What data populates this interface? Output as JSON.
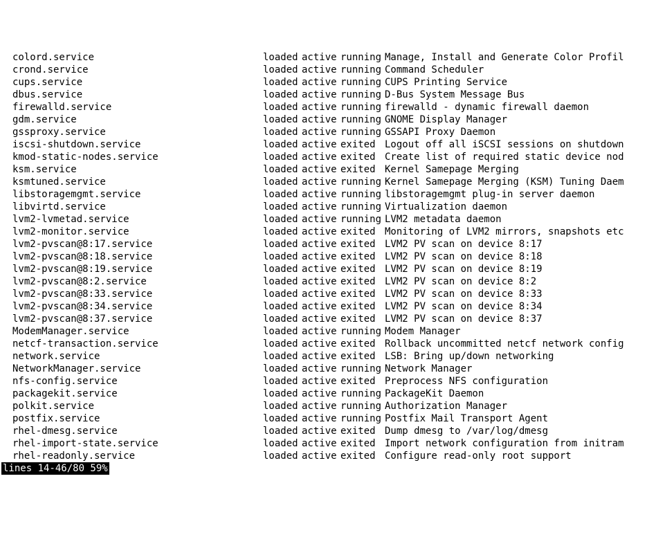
{
  "rows": [
    {
      "unit": "colord.service",
      "load": "loaded",
      "active": "active",
      "sub": "running",
      "desc": "Manage, Install and Generate Color Profil"
    },
    {
      "unit": "crond.service",
      "load": "loaded",
      "active": "active",
      "sub": "running",
      "desc": "Command Scheduler"
    },
    {
      "unit": "cups.service",
      "load": "loaded",
      "active": "active",
      "sub": "running",
      "desc": "CUPS Printing Service"
    },
    {
      "unit": "dbus.service",
      "load": "loaded",
      "active": "active",
      "sub": "running",
      "desc": "D-Bus System Message Bus"
    },
    {
      "unit": "firewalld.service",
      "load": "loaded",
      "active": "active",
      "sub": "running",
      "desc": "firewalld - dynamic firewall daemon"
    },
    {
      "unit": "gdm.service",
      "load": "loaded",
      "active": "active",
      "sub": "running",
      "desc": "GNOME Display Manager"
    },
    {
      "unit": "gssproxy.service",
      "load": "loaded",
      "active": "active",
      "sub": "running",
      "desc": "GSSAPI Proxy Daemon"
    },
    {
      "unit": "iscsi-shutdown.service",
      "load": "loaded",
      "active": "active",
      "sub": "exited ",
      "desc": "Logout off all iSCSI sessions on shutdown"
    },
    {
      "unit": "kmod-static-nodes.service",
      "load": "loaded",
      "active": "active",
      "sub": "exited ",
      "desc": "Create list of required static device nod"
    },
    {
      "unit": "ksm.service",
      "load": "loaded",
      "active": "active",
      "sub": "exited ",
      "desc": "Kernel Samepage Merging"
    },
    {
      "unit": "ksmtuned.service",
      "load": "loaded",
      "active": "active",
      "sub": "running",
      "desc": "Kernel Samepage Merging (KSM) Tuning Daem"
    },
    {
      "unit": "libstoragemgmt.service",
      "load": "loaded",
      "active": "active",
      "sub": "running",
      "desc": "libstoragemgmt plug-in server daemon"
    },
    {
      "unit": "libvirtd.service",
      "load": "loaded",
      "active": "active",
      "sub": "running",
      "desc": "Virtualization daemon"
    },
    {
      "unit": "lvm2-lvmetad.service",
      "load": "loaded",
      "active": "active",
      "sub": "running",
      "desc": "LVM2 metadata daemon"
    },
    {
      "unit": "lvm2-monitor.service",
      "load": "loaded",
      "active": "active",
      "sub": "exited ",
      "desc": "Monitoring of LVM2 mirrors, snapshots etc"
    },
    {
      "unit": "lvm2-pvscan@8:17.service",
      "load": "loaded",
      "active": "active",
      "sub": "exited ",
      "desc": "LVM2 PV scan on device 8:17"
    },
    {
      "unit": "lvm2-pvscan@8:18.service",
      "load": "loaded",
      "active": "active",
      "sub": "exited ",
      "desc": "LVM2 PV scan on device 8:18"
    },
    {
      "unit": "lvm2-pvscan@8:19.service",
      "load": "loaded",
      "active": "active",
      "sub": "exited ",
      "desc": "LVM2 PV scan on device 8:19"
    },
    {
      "unit": "lvm2-pvscan@8:2.service",
      "load": "loaded",
      "active": "active",
      "sub": "exited ",
      "desc": "LVM2 PV scan on device 8:2"
    },
    {
      "unit": "lvm2-pvscan@8:33.service",
      "load": "loaded",
      "active": "active",
      "sub": "exited ",
      "desc": "LVM2 PV scan on device 8:33"
    },
    {
      "unit": "lvm2-pvscan@8:34.service",
      "load": "loaded",
      "active": "active",
      "sub": "exited ",
      "desc": "LVM2 PV scan on device 8:34"
    },
    {
      "unit": "lvm2-pvscan@8:37.service",
      "load": "loaded",
      "active": "active",
      "sub": "exited ",
      "desc": "LVM2 PV scan on device 8:37"
    },
    {
      "unit": "ModemManager.service",
      "load": "loaded",
      "active": "active",
      "sub": "running",
      "desc": "Modem Manager"
    },
    {
      "unit": "netcf-transaction.service",
      "load": "loaded",
      "active": "active",
      "sub": "exited ",
      "desc": "Rollback uncommitted netcf network config"
    },
    {
      "unit": "network.service",
      "load": "loaded",
      "active": "active",
      "sub": "exited ",
      "desc": "LSB: Bring up/down networking"
    },
    {
      "unit": "NetworkManager.service",
      "load": "loaded",
      "active": "active",
      "sub": "running",
      "desc": "Network Manager"
    },
    {
      "unit": "nfs-config.service",
      "load": "loaded",
      "active": "active",
      "sub": "exited ",
      "desc": "Preprocess NFS configuration"
    },
    {
      "unit": "packagekit.service",
      "load": "loaded",
      "active": "active",
      "sub": "running",
      "desc": "PackageKit Daemon"
    },
    {
      "unit": "polkit.service",
      "load": "loaded",
      "active": "active",
      "sub": "running",
      "desc": "Authorization Manager"
    },
    {
      "unit": "postfix.service",
      "load": "loaded",
      "active": "active",
      "sub": "running",
      "desc": "Postfix Mail Transport Agent"
    },
    {
      "unit": "rhel-dmesg.service",
      "load": "loaded",
      "active": "active",
      "sub": "exited ",
      "desc": "Dump dmesg to /var/log/dmesg"
    },
    {
      "unit": "rhel-import-state.service",
      "load": "loaded",
      "active": "active",
      "sub": "exited ",
      "desc": "Import network configuration from initram"
    },
    {
      "unit": "rhel-readonly.service",
      "load": "loaded",
      "active": "active",
      "sub": "exited ",
      "desc": "Configure read-only root support"
    }
  ],
  "status": "lines 14-46/80 59%"
}
